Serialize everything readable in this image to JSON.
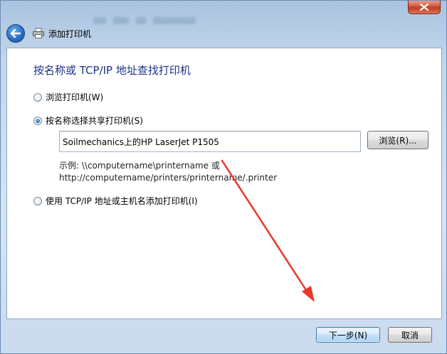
{
  "window": {
    "title": "添加打印机"
  },
  "page": {
    "heading": "按名称或 TCP/IP 地址查找打印机",
    "options": [
      {
        "label": "浏览打印机(W)",
        "selected": false
      },
      {
        "label": "按名称选择共享打印机(S)",
        "selected": true
      },
      {
        "label": "使用 TCP/IP 地址或主机名添加打印机(I)",
        "selected": false
      }
    ],
    "printer_name_value": "Soilmechanics上的HP LaserJet P1505",
    "browse_label": "浏览(R)...",
    "example_line1": "示例: \\\\computername\\printername 或",
    "example_line2": "http://computername/printers/printername/.printer"
  },
  "footer": {
    "next_label": "下一步(N)",
    "cancel_label": "取消"
  },
  "colors": {
    "heading": "#1e3287",
    "annotation_arrow": "#e8382a"
  },
  "icons": {
    "back": "back-arrow-icon",
    "printer": "printer-icon",
    "close": "close-icon"
  }
}
